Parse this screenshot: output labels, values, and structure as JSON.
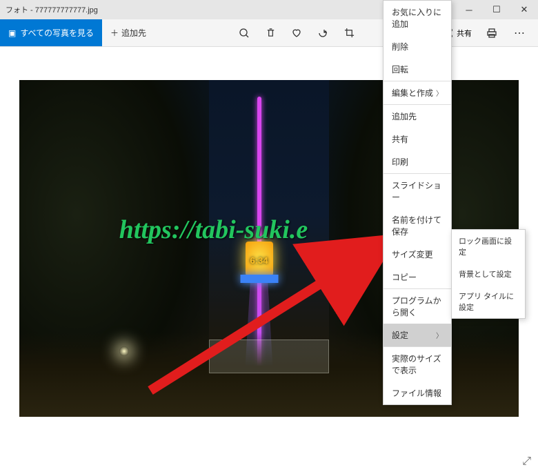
{
  "titlebar": {
    "title": "フォト - 777777777777.jpg"
  },
  "toolbar": {
    "all_photos": "すべての写真を見る",
    "add_to": "追加先",
    "share": "共有"
  },
  "photo": {
    "watermark": "https://tabi-suki.e",
    "tower_time": "6:34"
  },
  "context_menu": {
    "items": [
      {
        "label": "お気に入りに追加"
      },
      {
        "label": "削除"
      },
      {
        "label": "回転"
      }
    ],
    "group2": [
      {
        "label": "編集と作成",
        "submenu": true
      }
    ],
    "group3": [
      {
        "label": "追加先"
      },
      {
        "label": "共有"
      },
      {
        "label": "印刷"
      }
    ],
    "group4": [
      {
        "label": "スライドショー"
      },
      {
        "label": "名前を付けて保存"
      },
      {
        "label": "サイズ変更"
      },
      {
        "label": "コピー"
      }
    ],
    "group5": [
      {
        "label": "プログラムから開く"
      },
      {
        "label": "設定",
        "submenu": true,
        "highlighted": true
      },
      {
        "label": "実際のサイズで表示"
      },
      {
        "label": "ファイル情報"
      }
    ]
  },
  "submenu": {
    "items": [
      {
        "label": "ロック画面に設定"
      },
      {
        "label": "背景として設定"
      },
      {
        "label": "アプリ タイルに設定"
      }
    ]
  }
}
